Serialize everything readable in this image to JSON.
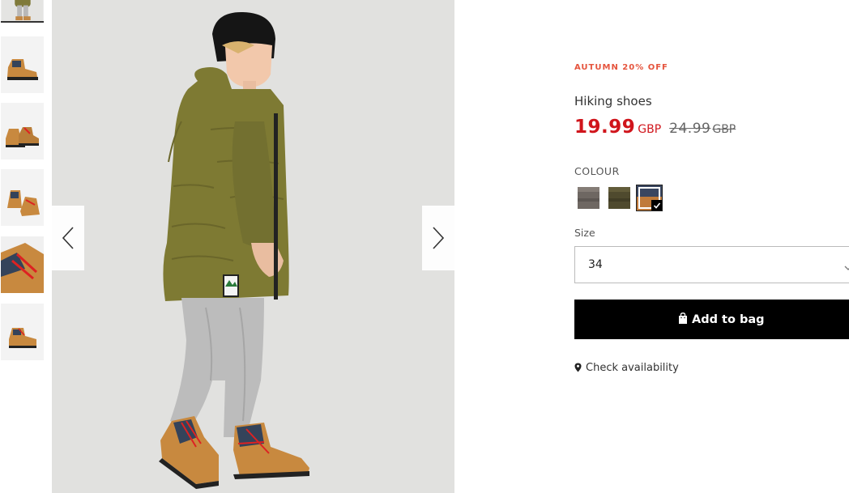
{
  "product": {
    "promo_label": "AUTUMN 20% OFF",
    "title": "Hiking shoes",
    "price_now": "19.99",
    "currency_now": "GBP",
    "price_old": "24.99",
    "currency_old": "GBP"
  },
  "colour": {
    "label": "COLOUR",
    "options": [
      {
        "name": "brown",
        "color": "#6e6762",
        "selected": false
      },
      {
        "name": "khaki",
        "color": "#4f4a2e",
        "selected": false
      },
      {
        "name": "camel-navy",
        "color": "#c07a3a",
        "selected": true
      }
    ]
  },
  "size": {
    "label": "Size",
    "value": "34"
  },
  "actions": {
    "add_to_bag": "Add to bag",
    "check_availability": "Check availability"
  },
  "gallery": {
    "thumbnail_count": 6,
    "active_index": 0,
    "icons": [
      "chevron-left-icon",
      "chevron-right-icon"
    ]
  },
  "colors": {
    "sale": "#d0151c",
    "promo": "#e5543d",
    "button": "#000000"
  }
}
